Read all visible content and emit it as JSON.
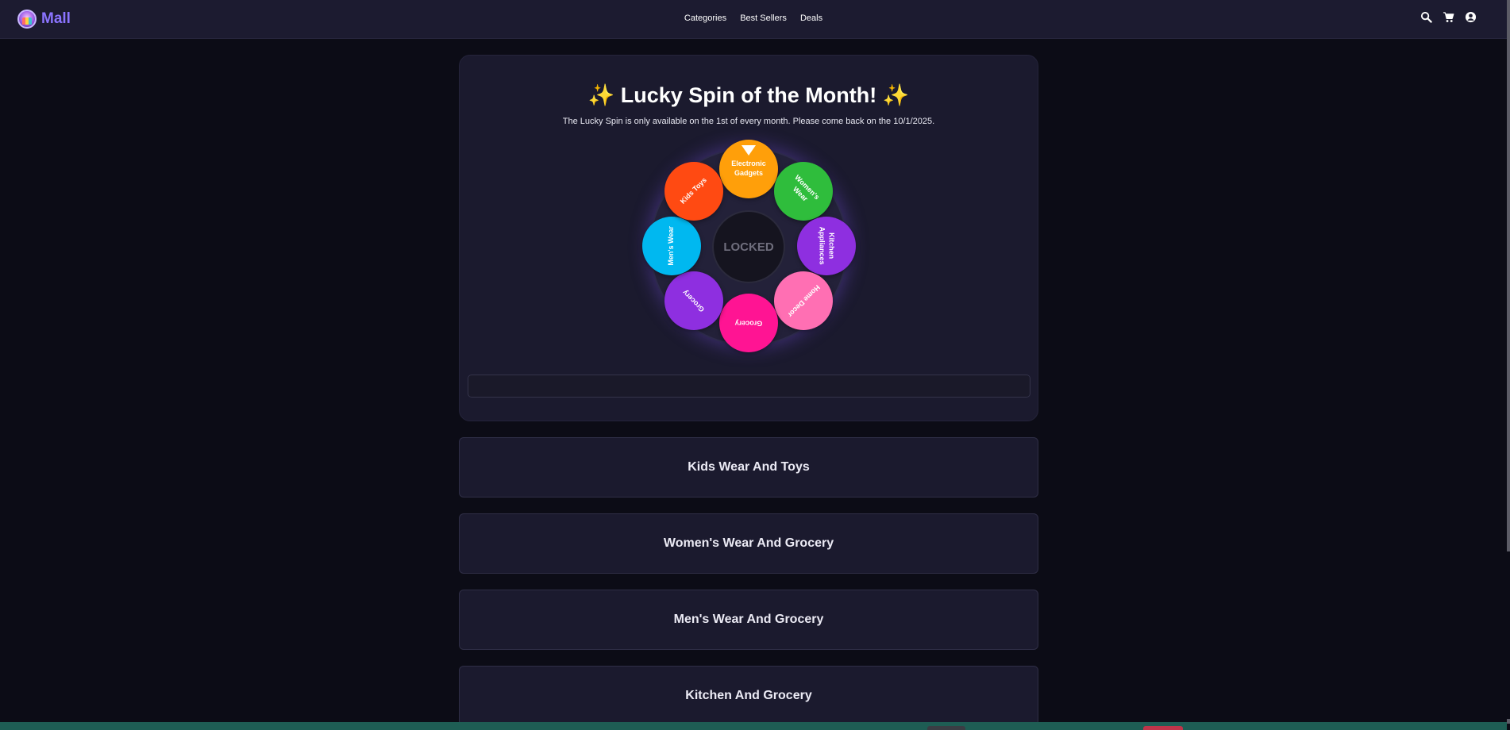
{
  "nav": {
    "brand": "Mall",
    "links": [
      "Categories",
      "Best Sellers",
      "Deals"
    ],
    "icons": [
      "search-icon",
      "cart-icon",
      "user-icon"
    ]
  },
  "spin": {
    "title": "✨ Lucky Spin of the Month! ✨",
    "subtitle": "The Lucky Spin is only available on the 1st of every month. Please come back on the 10/1/2025.",
    "center_label": "LOCKED",
    "result_text": "",
    "segments": [
      {
        "label": "Electronic Gadgets",
        "color": "#ff9f0a"
      },
      {
        "label": "Women's Wear",
        "color": "#2fbd3c"
      },
      {
        "label": "Kitchen Appliances",
        "color": "#8e2fe0"
      },
      {
        "label": "Home Decor",
        "color": "#ff6fb3"
      },
      {
        "label": "Grocery",
        "color": "#ff1493"
      },
      {
        "label": "Grocery",
        "color": "#8e2fe0"
      },
      {
        "label": "Men's Wear",
        "color": "#00b8f0"
      },
      {
        "label": "Kids Toys",
        "color": "#ff4a12"
      }
    ]
  },
  "categories": [
    "Kids Wear And Toys",
    "Women's Wear And Grocery",
    "Men's Wear And Grocery",
    "Kitchen And Grocery"
  ],
  "colors": {
    "background": "#0c0c16",
    "card": "#1b1a2e",
    "navbar": "#1c1b30",
    "brand": "#8b74ff"
  }
}
